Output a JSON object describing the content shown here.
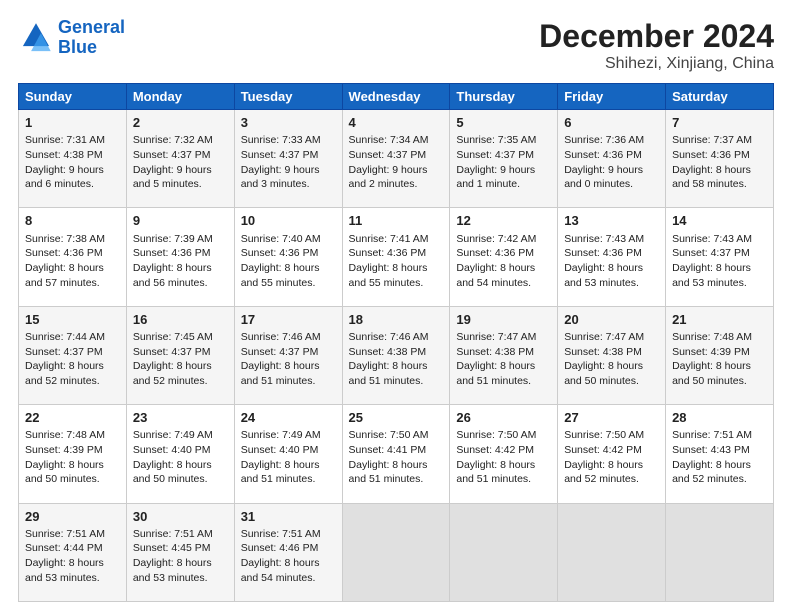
{
  "header": {
    "logo_line1": "General",
    "logo_line2": "Blue",
    "title": "December 2024",
    "subtitle": "Shihezi, Xinjiang, China"
  },
  "columns": [
    "Sunday",
    "Monday",
    "Tuesday",
    "Wednesday",
    "Thursday",
    "Friday",
    "Saturday"
  ],
  "weeks": [
    [
      {
        "day": "1",
        "lines": [
          "Sunrise: 7:31 AM",
          "Sunset: 4:38 PM",
          "Daylight: 9 hours",
          "and 6 minutes."
        ]
      },
      {
        "day": "2",
        "lines": [
          "Sunrise: 7:32 AM",
          "Sunset: 4:37 PM",
          "Daylight: 9 hours",
          "and 5 minutes."
        ]
      },
      {
        "day": "3",
        "lines": [
          "Sunrise: 7:33 AM",
          "Sunset: 4:37 PM",
          "Daylight: 9 hours",
          "and 3 minutes."
        ]
      },
      {
        "day": "4",
        "lines": [
          "Sunrise: 7:34 AM",
          "Sunset: 4:37 PM",
          "Daylight: 9 hours",
          "and 2 minutes."
        ]
      },
      {
        "day": "5",
        "lines": [
          "Sunrise: 7:35 AM",
          "Sunset: 4:37 PM",
          "Daylight: 9 hours",
          "and 1 minute."
        ]
      },
      {
        "day": "6",
        "lines": [
          "Sunrise: 7:36 AM",
          "Sunset: 4:36 PM",
          "Daylight: 9 hours",
          "and 0 minutes."
        ]
      },
      {
        "day": "7",
        "lines": [
          "Sunrise: 7:37 AM",
          "Sunset: 4:36 PM",
          "Daylight: 8 hours",
          "and 58 minutes."
        ]
      }
    ],
    [
      {
        "day": "8",
        "lines": [
          "Sunrise: 7:38 AM",
          "Sunset: 4:36 PM",
          "Daylight: 8 hours",
          "and 57 minutes."
        ]
      },
      {
        "day": "9",
        "lines": [
          "Sunrise: 7:39 AM",
          "Sunset: 4:36 PM",
          "Daylight: 8 hours",
          "and 56 minutes."
        ]
      },
      {
        "day": "10",
        "lines": [
          "Sunrise: 7:40 AM",
          "Sunset: 4:36 PM",
          "Daylight: 8 hours",
          "and 55 minutes."
        ]
      },
      {
        "day": "11",
        "lines": [
          "Sunrise: 7:41 AM",
          "Sunset: 4:36 PM",
          "Daylight: 8 hours",
          "and 55 minutes."
        ]
      },
      {
        "day": "12",
        "lines": [
          "Sunrise: 7:42 AM",
          "Sunset: 4:36 PM",
          "Daylight: 8 hours",
          "and 54 minutes."
        ]
      },
      {
        "day": "13",
        "lines": [
          "Sunrise: 7:43 AM",
          "Sunset: 4:36 PM",
          "Daylight: 8 hours",
          "and 53 minutes."
        ]
      },
      {
        "day": "14",
        "lines": [
          "Sunrise: 7:43 AM",
          "Sunset: 4:37 PM",
          "Daylight: 8 hours",
          "and 53 minutes."
        ]
      }
    ],
    [
      {
        "day": "15",
        "lines": [
          "Sunrise: 7:44 AM",
          "Sunset: 4:37 PM",
          "Daylight: 8 hours",
          "and 52 minutes."
        ]
      },
      {
        "day": "16",
        "lines": [
          "Sunrise: 7:45 AM",
          "Sunset: 4:37 PM",
          "Daylight: 8 hours",
          "and 52 minutes."
        ]
      },
      {
        "day": "17",
        "lines": [
          "Sunrise: 7:46 AM",
          "Sunset: 4:37 PM",
          "Daylight: 8 hours",
          "and 51 minutes."
        ]
      },
      {
        "day": "18",
        "lines": [
          "Sunrise: 7:46 AM",
          "Sunset: 4:38 PM",
          "Daylight: 8 hours",
          "and 51 minutes."
        ]
      },
      {
        "day": "19",
        "lines": [
          "Sunrise: 7:47 AM",
          "Sunset: 4:38 PM",
          "Daylight: 8 hours",
          "and 51 minutes."
        ]
      },
      {
        "day": "20",
        "lines": [
          "Sunrise: 7:47 AM",
          "Sunset: 4:38 PM",
          "Daylight: 8 hours",
          "and 50 minutes."
        ]
      },
      {
        "day": "21",
        "lines": [
          "Sunrise: 7:48 AM",
          "Sunset: 4:39 PM",
          "Daylight: 8 hours",
          "and 50 minutes."
        ]
      }
    ],
    [
      {
        "day": "22",
        "lines": [
          "Sunrise: 7:48 AM",
          "Sunset: 4:39 PM",
          "Daylight: 8 hours",
          "and 50 minutes."
        ]
      },
      {
        "day": "23",
        "lines": [
          "Sunrise: 7:49 AM",
          "Sunset: 4:40 PM",
          "Daylight: 8 hours",
          "and 50 minutes."
        ]
      },
      {
        "day": "24",
        "lines": [
          "Sunrise: 7:49 AM",
          "Sunset: 4:40 PM",
          "Daylight: 8 hours",
          "and 51 minutes."
        ]
      },
      {
        "day": "25",
        "lines": [
          "Sunrise: 7:50 AM",
          "Sunset: 4:41 PM",
          "Daylight: 8 hours",
          "and 51 minutes."
        ]
      },
      {
        "day": "26",
        "lines": [
          "Sunrise: 7:50 AM",
          "Sunset: 4:42 PM",
          "Daylight: 8 hours",
          "and 51 minutes."
        ]
      },
      {
        "day": "27",
        "lines": [
          "Sunrise: 7:50 AM",
          "Sunset: 4:42 PM",
          "Daylight: 8 hours",
          "and 52 minutes."
        ]
      },
      {
        "day": "28",
        "lines": [
          "Sunrise: 7:51 AM",
          "Sunset: 4:43 PM",
          "Daylight: 8 hours",
          "and 52 minutes."
        ]
      }
    ],
    [
      {
        "day": "29",
        "lines": [
          "Sunrise: 7:51 AM",
          "Sunset: 4:44 PM",
          "Daylight: 8 hours",
          "and 53 minutes."
        ]
      },
      {
        "day": "30",
        "lines": [
          "Sunrise: 7:51 AM",
          "Sunset: 4:45 PM",
          "Daylight: 8 hours",
          "and 53 minutes."
        ]
      },
      {
        "day": "31",
        "lines": [
          "Sunrise: 7:51 AM",
          "Sunset: 4:46 PM",
          "Daylight: 8 hours",
          "and 54 minutes."
        ]
      },
      null,
      null,
      null,
      null
    ]
  ]
}
